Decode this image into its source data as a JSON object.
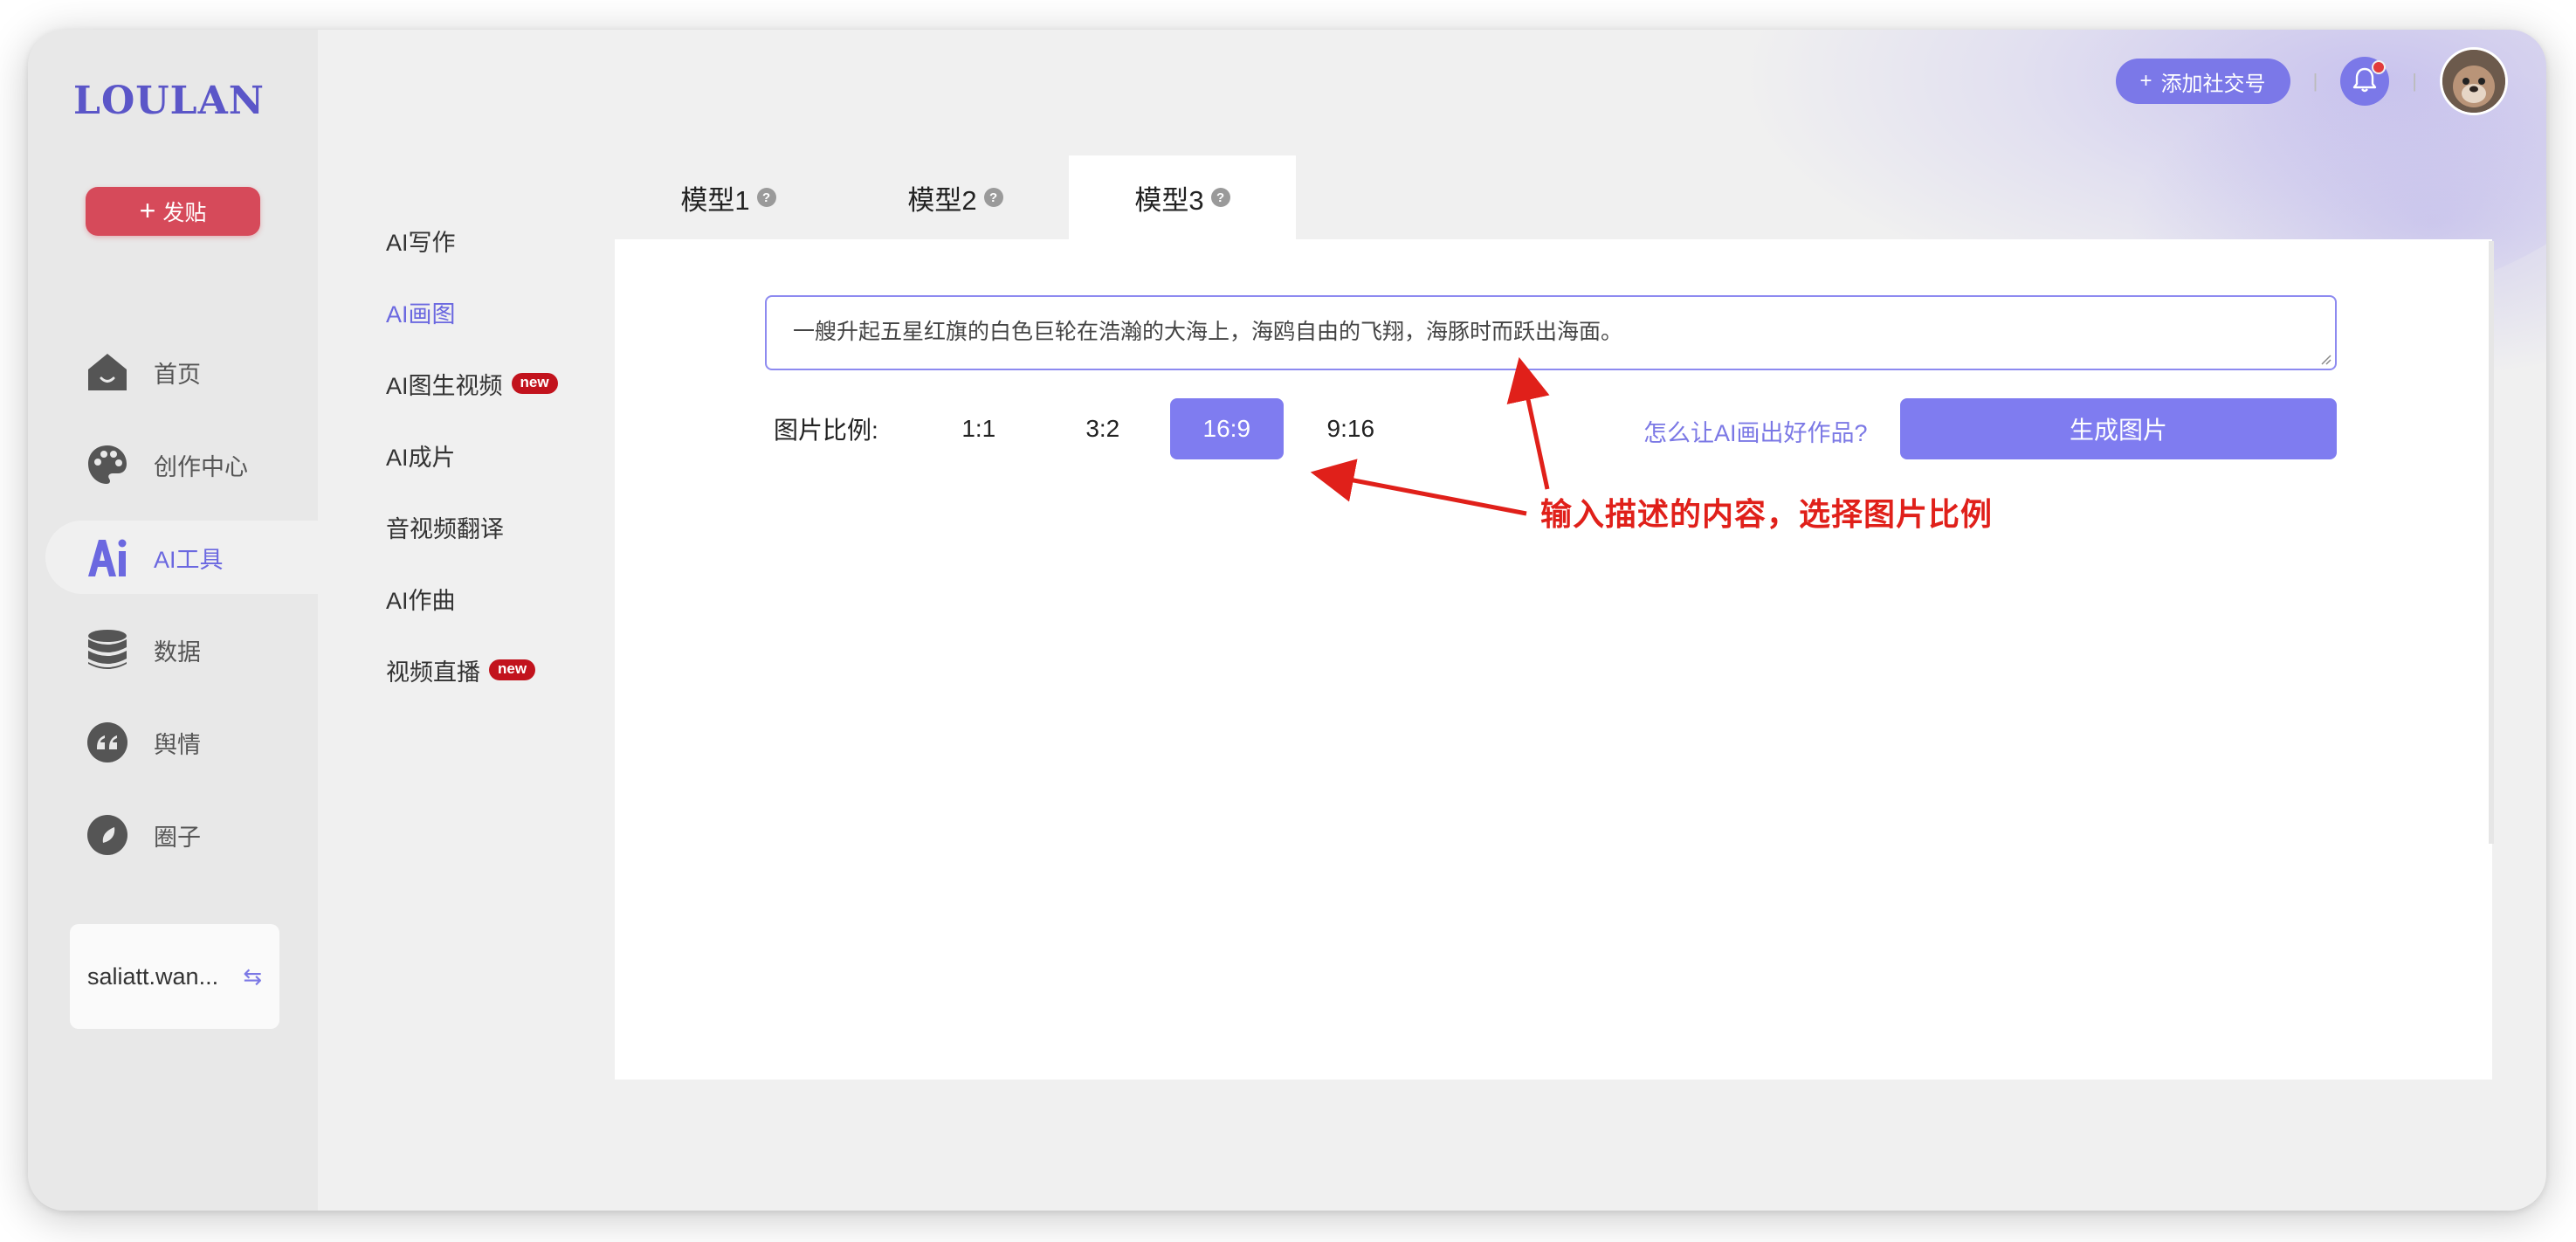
{
  "app": {
    "logo": "LOULAN"
  },
  "sidebar": {
    "post_button": "发贴",
    "items": [
      {
        "label": "首页",
        "icon": "home-icon"
      },
      {
        "label": "创作中心",
        "icon": "palette-icon"
      },
      {
        "label": "AI工具",
        "icon": "ai-icon",
        "active": true
      },
      {
        "label": "数据",
        "icon": "database-icon"
      },
      {
        "label": "舆情",
        "icon": "quote-icon"
      },
      {
        "label": "圈子",
        "icon": "compass-icon"
      }
    ],
    "account": {
      "name": "saliatt.wan...",
      "icon": "switch-account-icon"
    }
  },
  "submenu": {
    "items": [
      {
        "label": "AI写作"
      },
      {
        "label": "AI画图",
        "active": true
      },
      {
        "label": "AI图生视频",
        "badge": "new"
      },
      {
        "label": "AI成片"
      },
      {
        "label": "音视频翻译"
      },
      {
        "label": "AI作曲"
      },
      {
        "label": "视频直播",
        "badge": "new"
      }
    ]
  },
  "header": {
    "add_social": "添加社交号",
    "notification_icon": "bell-icon",
    "has_unread": true
  },
  "tabs": [
    {
      "label": "模型1",
      "help": "?"
    },
    {
      "label": "模型2",
      "help": "?"
    },
    {
      "label": "模型3",
      "help": "?",
      "active": true
    }
  ],
  "editor": {
    "prompt_value": "一艘升起五星红旗的白色巨轮在浩瀚的大海上，海鸥自由的飞翔，海豚时而跃出海面。",
    "ratio_label": "图片比例:",
    "ratios": [
      "1:1",
      "3:2",
      "16:9",
      "9:16"
    ],
    "selected_ratio": "16:9",
    "help_link": "怎么让AI画出好作品?",
    "generate_button": "生成图片"
  },
  "annotation": {
    "text": "输入描述的内容，选择图片比例",
    "color": "#e0201a"
  },
  "colors": {
    "accent": "#7f7cf0",
    "post_button": "#d64a5a",
    "badge_new": "#c2131d"
  }
}
